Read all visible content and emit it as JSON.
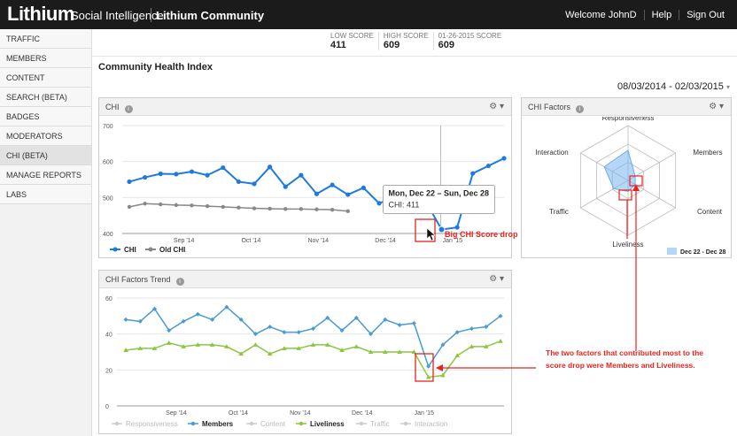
{
  "header": {
    "logo": "Lithium",
    "app_name": "Social Intelligence",
    "community": "Lithium Community",
    "welcome": "Welcome JohnD",
    "help": "Help",
    "signout": "Sign Out"
  },
  "sidebar": {
    "items": [
      {
        "label": "TRAFFIC"
      },
      {
        "label": "MEMBERS"
      },
      {
        "label": "CONTENT"
      },
      {
        "label": "SEARCH (BETA)"
      },
      {
        "label": "BADGES"
      },
      {
        "label": "MODERATORS"
      },
      {
        "label": "CHI (BETA)"
      },
      {
        "label": "MANAGE REPORTS"
      },
      {
        "label": "LABS"
      }
    ],
    "active": "CHI (BETA)"
  },
  "scores": [
    {
      "label": "LOW SCORE",
      "value": "411"
    },
    {
      "label": "HIGH SCORE",
      "value": "609"
    },
    {
      "label": "01-26-2015 SCORE",
      "value": "609"
    }
  ],
  "page_title": "Community Health Index",
  "date_range": "08/03/2014 - 02/03/2015",
  "panels": {
    "chi": "CHI",
    "factors": "CHI Factors",
    "trend": "CHI Factors Trend"
  },
  "colors": {
    "chi": "#1e7ae0",
    "old_chi": "#888888",
    "members": "#4a9ad4",
    "liveliness": "#8cc63f",
    "faded": "#cccccc",
    "annotation": "#e8231f"
  },
  "tooltip": {
    "title": "Mon, Dec 22 – Sun, Dec 28",
    "value": "CHI: 411"
  },
  "annotations": {
    "drop": "Big CHI Score drop",
    "factors_line1": "The two factors that contributed most to the",
    "factors_line2": "score drop were Members and Liveliness."
  },
  "chart_data": [
    {
      "type": "line",
      "title": "CHI",
      "categories_ticks": [
        "Sep '14",
        "Oct '14",
        "Nov '14",
        "Dec '14",
        "Jan '15"
      ],
      "yticks": [
        "700",
        "600",
        "500",
        "400"
      ],
      "ylim": [
        400,
        700
      ],
      "legend": "bottom-left",
      "series": [
        {
          "name": "CHI",
          "values": [
            544,
            556,
            566,
            565,
            572,
            562,
            583,
            544,
            538,
            585,
            530,
            562,
            510,
            535,
            508,
            527,
            484,
            500,
            498,
            488,
            411,
            417,
            567,
            588,
            609
          ]
        },
        {
          "name": "Old CHI",
          "values": [
            474,
            483,
            481,
            479,
            478,
            476,
            474,
            472,
            470,
            469,
            468,
            468,
            467,
            466,
            462
          ]
        }
      ]
    },
    {
      "type": "radar",
      "title": "CHI Factors",
      "axes": [
        "Responsiveness",
        "Members",
        "Content",
        "Liveliness",
        "Traffic",
        "Interaction"
      ],
      "legend": "Dec 22 - Dec 28",
      "series": [
        {
          "name": "Dec 22 - Dec 28",
          "values": [
            0.55,
            0.15,
            0.15,
            0.2,
            0.3,
            0.5
          ]
        }
      ]
    },
    {
      "type": "line",
      "title": "CHI Factors Trend",
      "categories_ticks": [
        "Sep '14",
        "Oct '14",
        "Nov '14",
        "Dec '14",
        "Jan '15"
      ],
      "yticks": [
        "60",
        "40",
        "20",
        "0"
      ],
      "ylim": [
        0,
        60
      ],
      "legend": [
        "Responsiveness",
        "Members",
        "Content",
        "Liveliness",
        "Traffic",
        "Interaction"
      ],
      "series": [
        {
          "name": "Members",
          "values": [
            48,
            47,
            54,
            42,
            47,
            51,
            48,
            55,
            48,
            40,
            44,
            41,
            41,
            43,
            49,
            42,
            49,
            40,
            48,
            45,
            46,
            22,
            34,
            41,
            43,
            44,
            50
          ]
        },
        {
          "name": "Liveliness",
          "values": [
            31,
            32,
            32,
            35,
            33,
            34,
            34,
            33,
            29,
            34,
            29,
            32,
            32,
            34,
            34,
            31,
            33,
            30,
            30,
            30,
            30,
            16,
            17,
            28,
            33,
            33,
            36
          ]
        }
      ]
    }
  ]
}
